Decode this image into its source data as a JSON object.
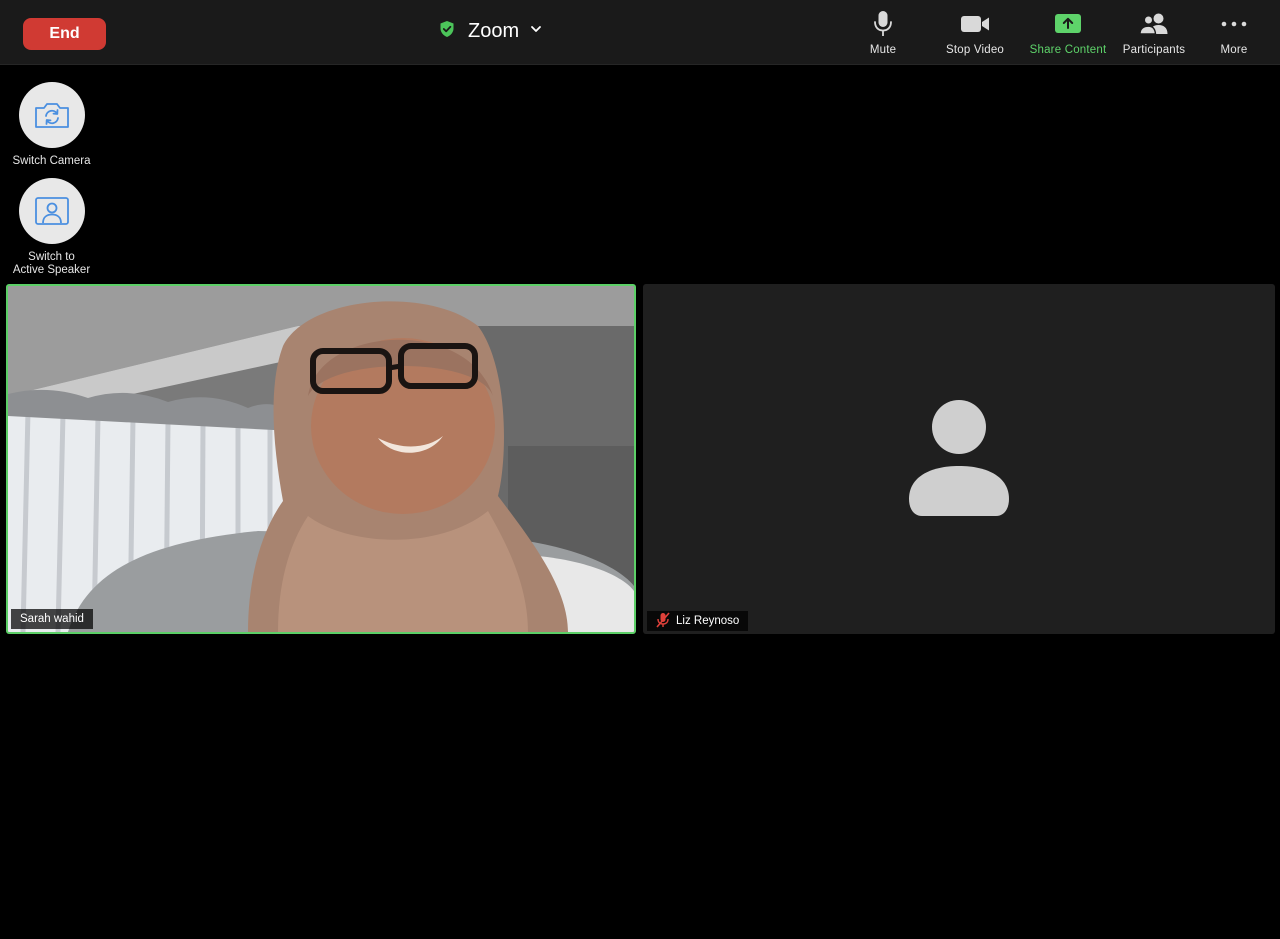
{
  "topbar": {
    "end_label": "End",
    "meeting_title": "Zoom",
    "security_icon": "shield-check-icon",
    "tools": [
      {
        "label": "Mute",
        "icon": "microphone-icon",
        "active": false
      },
      {
        "label": "Stop Video",
        "icon": "video-camera-icon",
        "active": false
      },
      {
        "label": "Share Content",
        "icon": "share-screen-icon",
        "active": true
      },
      {
        "label": "Participants",
        "icon": "participants-icon",
        "active": false
      },
      {
        "label": "More",
        "icon": "more-dots-icon",
        "active": false
      }
    ]
  },
  "side": {
    "switch_camera_label": "Switch Camera",
    "switch_speaker_line1": "Switch to",
    "switch_speaker_line2": "Active Speaker"
  },
  "participants": [
    {
      "name": "Sarah wahid",
      "speaking": true,
      "muted": false,
      "video_on": true
    },
    {
      "name": "Liz Reynoso",
      "speaking": false,
      "muted": true,
      "video_on": false
    }
  ],
  "colors": {
    "end_button": "#d03a33",
    "active_green": "#5ed36a",
    "topbar_bg": "#1a1a1a",
    "tile_bg": "#1f1f1f",
    "speaker_border": "#5ccf67",
    "muted_red": "#e0413a"
  }
}
